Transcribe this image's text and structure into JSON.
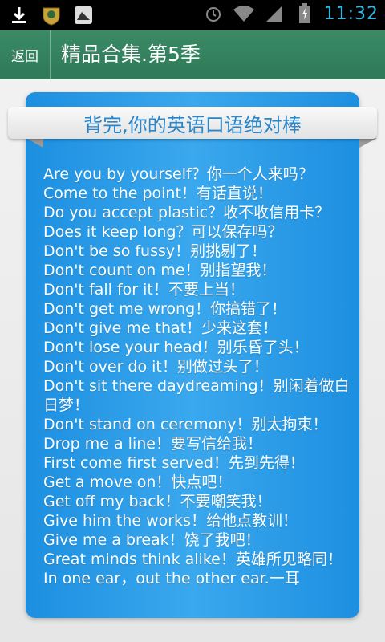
{
  "status_bar": {
    "time": "11:32",
    "icons": [
      "download-icon",
      "app-badge-icon",
      "image-icon",
      "alarm-icon",
      "wifi-icon",
      "signal-icon",
      "battery-charging-icon"
    ]
  },
  "action_bar": {
    "back_label": "返回",
    "title": "精品合集.第5季",
    "color": "#2f7a58"
  },
  "card": {
    "heading": "背完,你的英语口语绝对棒",
    "accent": "#2a86c8",
    "phrases": [
      "Are you by yourself？你一个人来吗？",
      "Come to the point！有话直说！",
      "Do you accept plastic？收不收信用卡？",
      "Does it keep long？可以保存吗？",
      "Don't be so fussy！别挑剔了！",
      "Don't count on me！别指望我！",
      "Don't fall for it！不要上当！",
      "Don't get me wrong！你搞错了！",
      "Don't give me that！少来这套！",
      "Don't lose your head！别乐昏了头！",
      "Don't over do it！别做过头了！",
      "Don't sit there daydreaming！别闲着做白日梦！",
      "Don't stand on ceremony！别太拘束！",
      "Drop me a line！要写信给我！",
      "First come first served！先到先得！",
      "Get a move on！快点吧！",
      "Get off my back！不要嘲笑我！",
      "Give him the works！给他点教训！",
      "Give me a break！饶了我吧！",
      "Great minds think alike！英雄所见略同！",
      "In one ear，out the other ear.一耳"
    ]
  }
}
